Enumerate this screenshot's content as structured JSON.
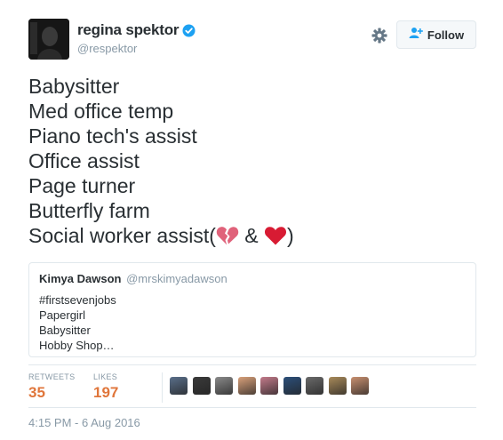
{
  "author": {
    "display_name": "regina spektor",
    "handle": "@respektor",
    "verified": true
  },
  "actions": {
    "follow_label": "Follow"
  },
  "tweet": {
    "lines": [
      "Babysitter",
      "Med office temp",
      "Piano tech's assist",
      "Office assist",
      "Page turner",
      "Butterfly farm"
    ],
    "last_line_prefix": "Social worker assist(",
    "last_line_mid": " & ",
    "last_line_suffix": ")",
    "emoji_1": "broken-heart-icon",
    "emoji_2": "red-heart-icon"
  },
  "quoted_tweet": {
    "name": "Kimya Dawson",
    "handle": "@mrskimyadawson",
    "lines": [
      "#firstsevenjobs",
      "Papergirl",
      "Babysitter",
      "Hobby Shop…"
    ]
  },
  "stats": {
    "retweets_label": "RETWEETS",
    "retweets": "35",
    "likes_label": "LIKES",
    "likes": "197"
  },
  "likers": [
    {
      "color": "#5a6f8a"
    },
    {
      "color": "#3a3a3a"
    },
    {
      "color": "#8a8a8a"
    },
    {
      "color": "#d8a07a"
    },
    {
      "color": "#c27a8a"
    },
    {
      "color": "#2c4f7a"
    },
    {
      "color": "#6a6a6a"
    },
    {
      "color": "#a88a5a"
    },
    {
      "color": "#c89070"
    }
  ],
  "timestamp": "4:15 PM - 6 Aug 2016",
  "colors": {
    "accent": "#e0763b",
    "verified": "#1da1f2",
    "follow_icon": "#1da1f2"
  }
}
